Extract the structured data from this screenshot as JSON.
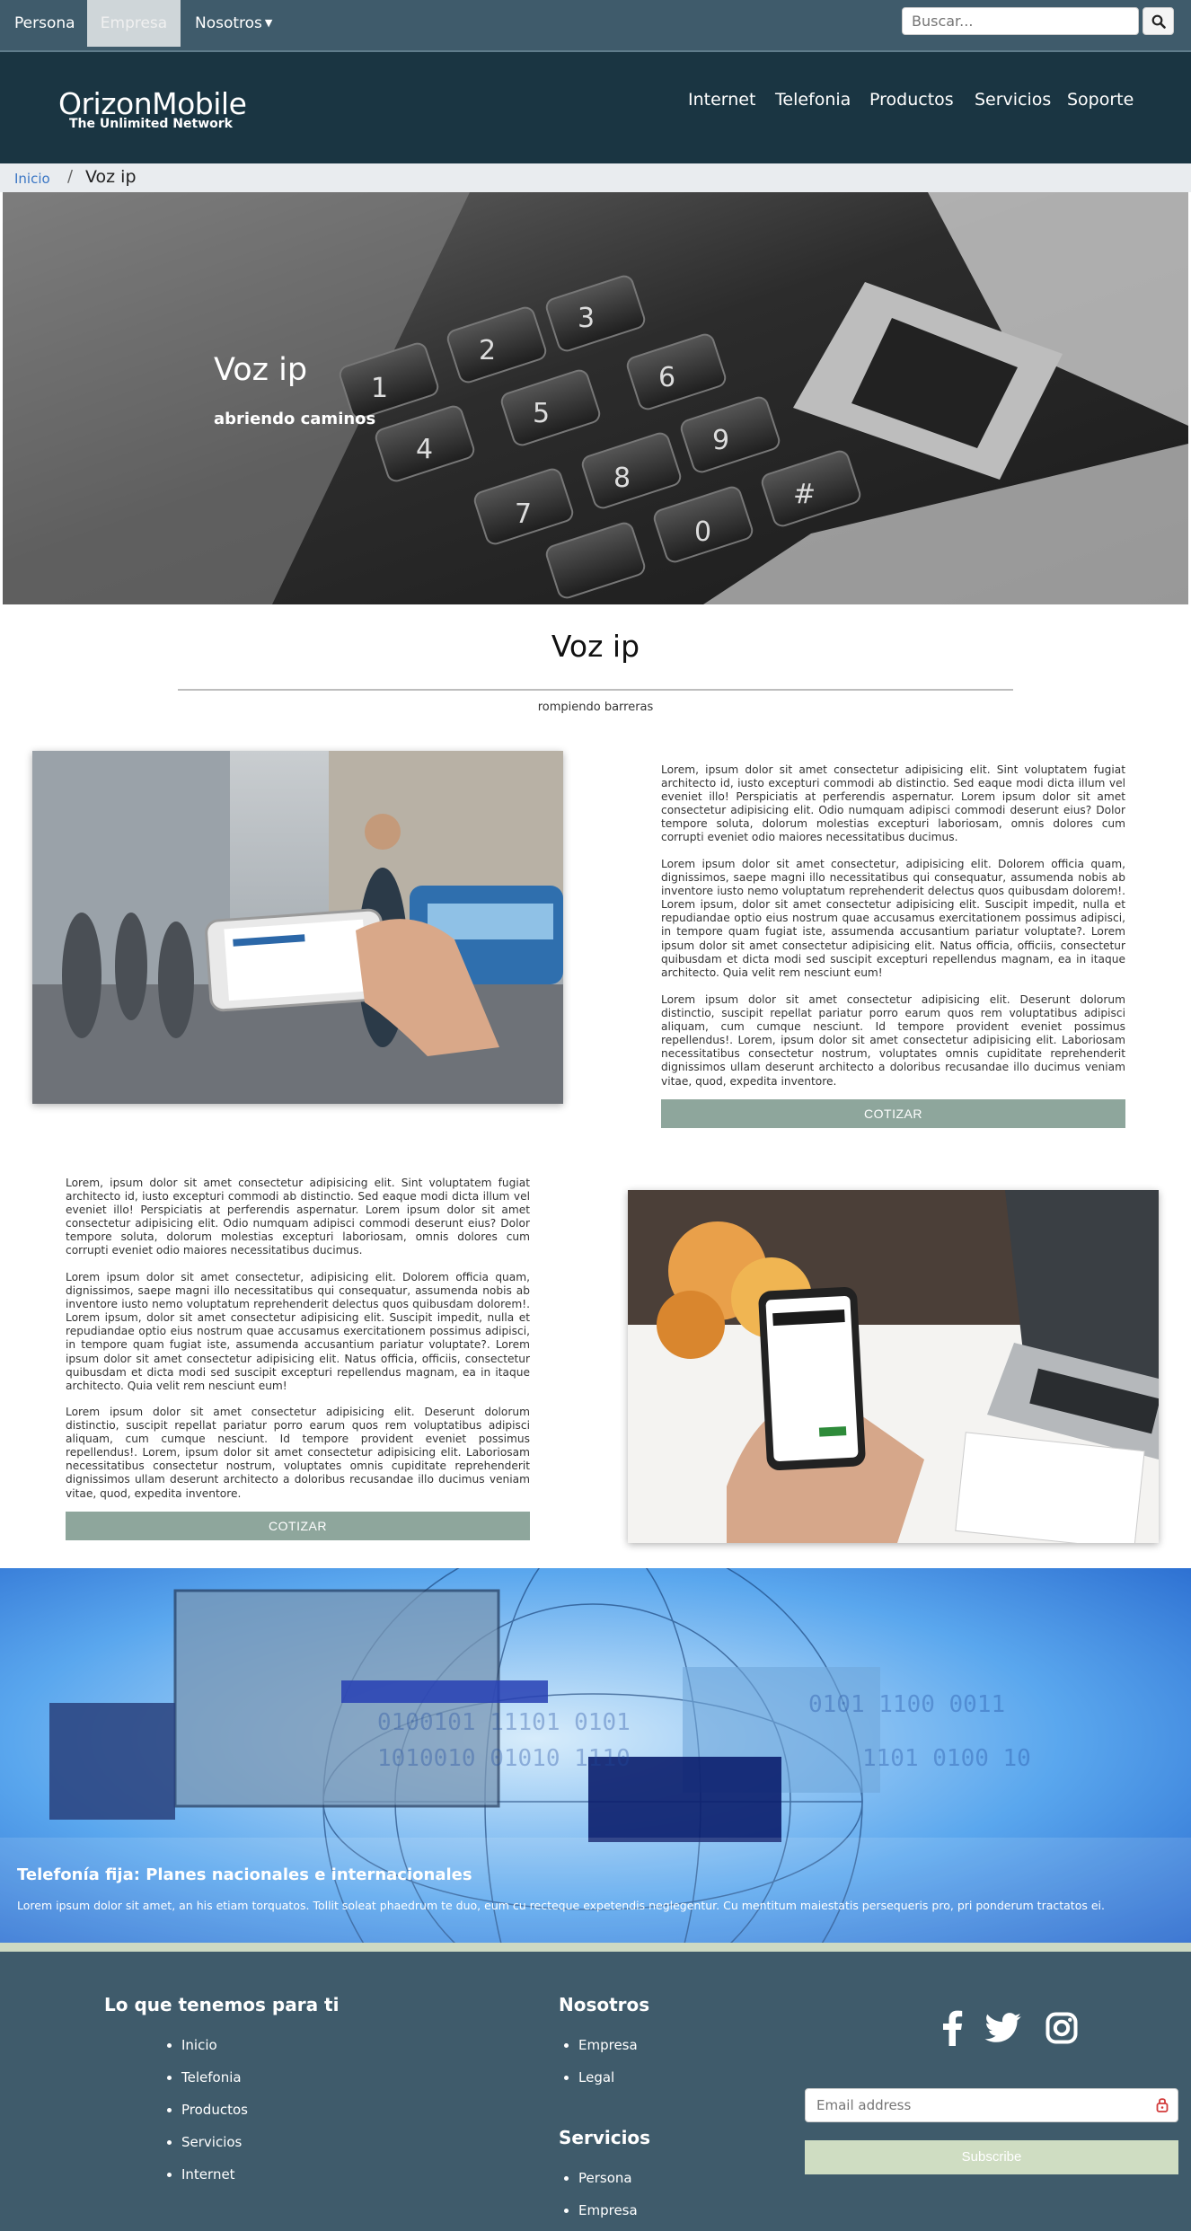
{
  "topbar": {
    "tabs": [
      {
        "label": "Persona"
      },
      {
        "label": "Empresa"
      },
      {
        "label": "Nosotros"
      }
    ],
    "search_placeholder": "Buscar..."
  },
  "header": {
    "logo": "OrizonMobile",
    "tagline": "The Unlimited Network",
    "nav": [
      "Internet",
      "Telefonia",
      "Productos",
      "Servicios",
      "Soporte"
    ]
  },
  "breadcrumb": {
    "home": "Inicio",
    "separator": "/",
    "current": "Voz ip"
  },
  "hero": {
    "title": "Voz ip",
    "subtitle": "abriendo caminos"
  },
  "section": {
    "title": "Voz ip",
    "subtitle": "rompiendo barreras",
    "paragraphs": [
      "Lorem, ipsum dolor sit amet consectetur adipisicing elit. Sint voluptatem fugiat architecto id, iusto excepturi commodi ab distinctio. Sed eaque modi dicta illum vel eveniet illo! Perspiciatis at perferendis aspernatur. Lorem ipsum dolor sit amet consectetur adipisicing elit. Odio numquam adipisci commodi deserunt eius? Dolor tempore soluta, dolorum molestias excepturi laboriosam, omnis dolores cum corrupti eveniet odio maiores necessitatibus ducimus.",
      "Lorem ipsum dolor sit amet consectetur, adipisicing elit. Dolorem officia quam, dignissimos, saepe magni illo necessitatibus qui consequatur, assumenda nobis ab inventore iusto nemo voluptatum reprehenderit delectus quos quibusdam dolorem!. Lorem ipsum, dolor sit amet consectetur adipisicing elit. Suscipit impedit, nulla et repudiandae optio eius nostrum quae accusamus exercitationem possimus adipisci, in tempore quam fugiat iste, assumenda accusantium pariatur voluptate?. Lorem ipsum dolor sit amet consectetur adipisicing elit. Natus officia, officiis, consectetur quibusdam et dicta modi sed suscipit excepturi repellendus magnam, ea in itaque architecto. Quia velit rem nesciunt eum!",
      "Lorem ipsum dolor sit amet consectetur adipisicing elit. Deserunt dolorum distinctio, suscipit repellat pariatur porro earum quos rem voluptatibus adipisci aliquam, cum cumque nesciunt. Id tempore provident eveniet possimus repellendus!. Lorem, ipsum dolor sit amet consectetur adipisicing elit. Laboriosam necessitatibus consectetur nostrum, voluptates omnis cupiditate reprehenderit dignissimos ullam deserunt architecto a doloribus recusandae illo ducimus veniam vitae, quod, expedita inventore."
    ],
    "cta_label": "COTIZAR"
  },
  "banner": {
    "title": "Telefonía fija: Planes nacionales e internacionales",
    "text": "Lorem ipsum dolor sit amet, an his etiam torquatos. Tollit soleat phaedrum te duo, eum cu recteque expetendis neglegentur. Cu mentitum maiestatis persequeris pro, pri ponderum tractatos ei."
  },
  "footer": {
    "col1_title": "Lo que tenemos para ti",
    "col1_items": [
      "Inicio",
      "Telefonia",
      "Productos",
      "Servicios",
      "Internet"
    ],
    "col2_title": "Nosotros",
    "col2_items": [
      "Empresa",
      "Legal"
    ],
    "col3_title": "Servicios",
    "col3_items": [
      "Persona",
      "Empresa"
    ],
    "email_placeholder": "Email address",
    "subscribe_label": "Subscribe"
  }
}
